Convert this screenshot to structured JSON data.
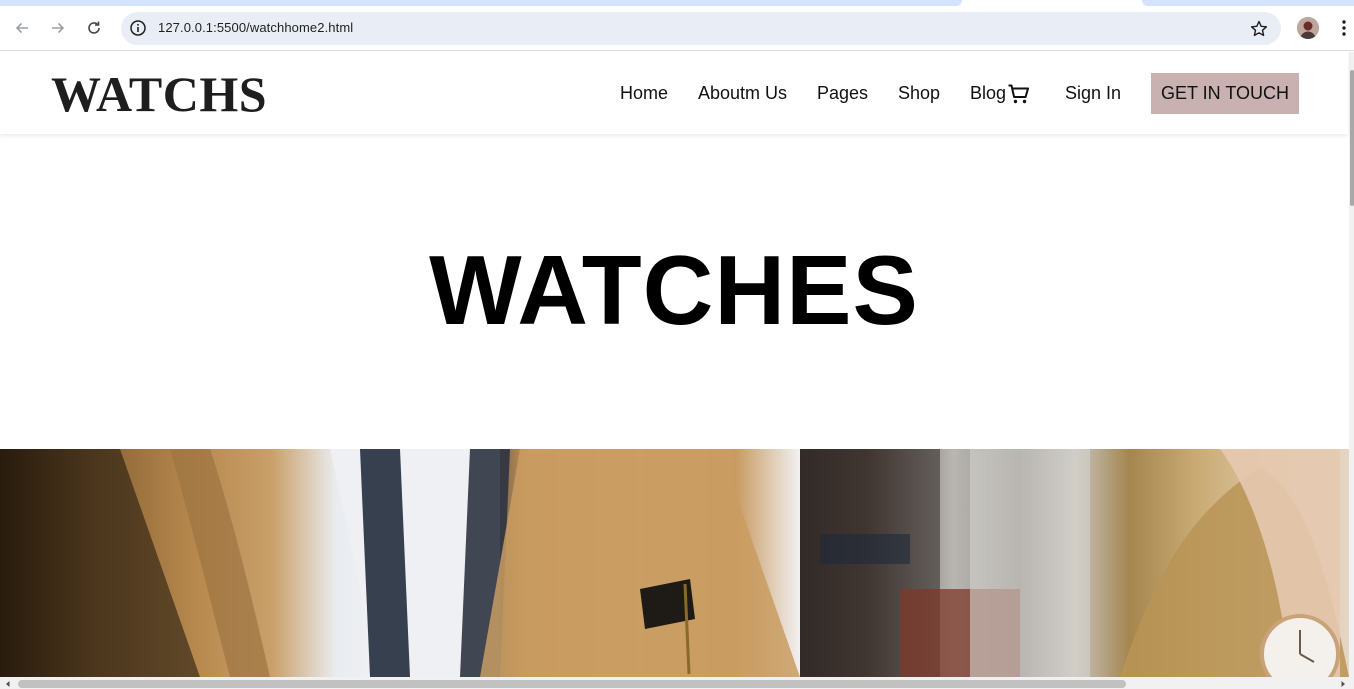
{
  "browser": {
    "url": "127.0.0.1:5500/watchhome2.html",
    "tab_color": "#d3e3fd",
    "omnibox_color": "#e9eef6"
  },
  "header": {
    "logo": "WATCHS",
    "nav": [
      {
        "label": "Home"
      },
      {
        "label": "Aboutm Us"
      },
      {
        "label": "Pages"
      },
      {
        "label": "Shop"
      },
      {
        "label": "Blog"
      }
    ],
    "cart_icon": "cart-icon",
    "signin_label": "Sign In",
    "cta_label": "GET IN TOUCH",
    "cta_color": "#c9b1b1"
  },
  "hero": {
    "title": "WATCHES"
  },
  "gallery": {
    "images": [
      {
        "name": "man-in-tan-suit-photo"
      },
      {
        "name": "wrist-watch-photo"
      }
    ]
  }
}
